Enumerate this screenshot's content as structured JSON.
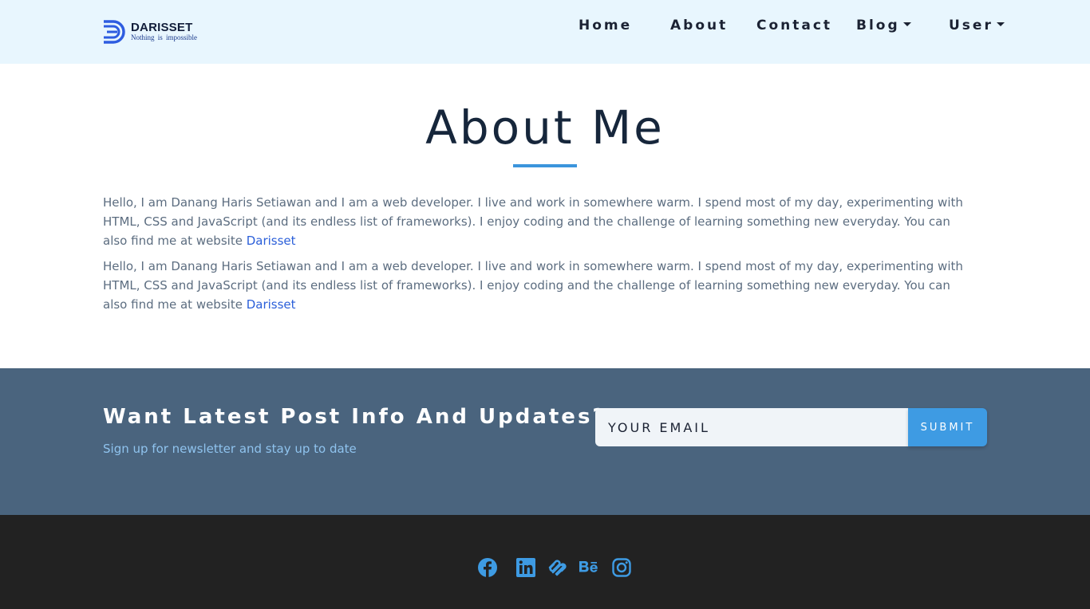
{
  "brand": {
    "name": "DARISSET",
    "tagline": "Nothing is impossible"
  },
  "nav": {
    "home": "Home",
    "about": "About",
    "contact": "Contact",
    "blog": "Blog",
    "user": "User"
  },
  "main": {
    "title": "About Me",
    "paragraphs": [
      {
        "text": "Hello, I am Danang Haris Setiawan and I am a web developer. I live and work in somewhere warm. I spend most of my day, experimenting with HTML, CSS and JavaScript (and its endless list of frameworks). I enjoy coding and the challenge of learning something new everyday. You can also find me at website ",
        "link": "Darisset"
      },
      {
        "text": "Hello, I am Danang Haris Setiawan and I am a web developer. I live and work in somewhere warm. I spend most of my day, experimenting with HTML, CSS and JavaScript (and its endless list of frameworks). I enjoy coding and the challenge of learning something new everyday. You can also find me at website ",
        "link": "Darisset"
      }
    ]
  },
  "newsletter": {
    "title": "Want Latest Post Info And Updates?",
    "subtitle": "Sign up for newsletter and stay up to date",
    "email_placeholder": "YOUR EMAIL",
    "submit_label": "SUBMIT"
  },
  "footer": {
    "social_icons": [
      "facebook-icon",
      "linkedin-icon",
      "squarespace-icon",
      "behance-icon",
      "instagram-icon"
    ]
  },
  "colors": {
    "navbar_bg": "#e8f6fe",
    "accent": "#3e9be3",
    "newsletter_bg": "#4a647e",
    "footer_bg": "#222222",
    "link": "#2b5fd9"
  }
}
